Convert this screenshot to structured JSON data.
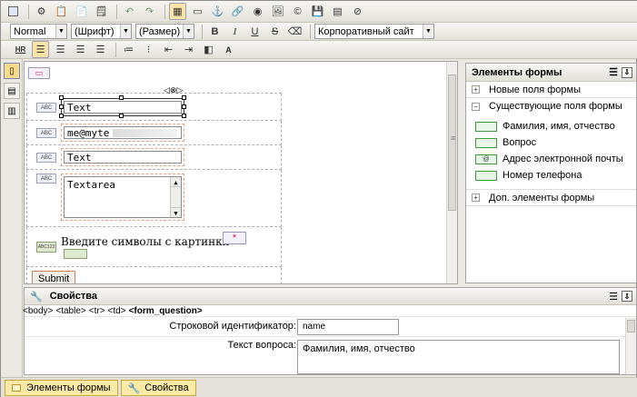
{
  "toolbar": {
    "style_value": "Normal",
    "font_value": "(Шрифт)",
    "size_value": "(Размер)",
    "css_class_value": "Корпоративный сайт",
    "bold": "B",
    "italic": "I",
    "underline": "U",
    "strike": "S",
    "hr": "HR"
  },
  "editor": {
    "rows": [
      {
        "type": "ABC",
        "value": "Text"
      },
      {
        "type": "ABC",
        "value": "me@myte"
      },
      {
        "type": "ABC",
        "value": "Text"
      },
      {
        "type": "ABC",
        "value": "Textarea"
      }
    ],
    "captcha_label": "Введите символы с картинки",
    "captcha_required_mark": "*",
    "captcha_icon_text": "ABC123",
    "submit_label": "Submit"
  },
  "sidepanel": {
    "title": "Элементы формы",
    "sections": [
      {
        "label": "Новые поля формы",
        "expanded": false
      },
      {
        "label": "Существующие поля формы",
        "expanded": true
      },
      {
        "label": "Доп. элементы формы",
        "expanded": false
      }
    ],
    "existing_fields": [
      "Фамилия, имя, отчество",
      "Вопрос",
      "Адрес электронной почты",
      "Номер телефона"
    ]
  },
  "properties": {
    "title": "Свойства",
    "breadcrumb": [
      "<body>",
      "<table>",
      "<tr>",
      "<td>"
    ],
    "breadcrumb_current": "<form_question>",
    "string_id_label": "Строковой идентификатор:",
    "string_id_value": "name",
    "question_text_label": "Текст вопроса:",
    "question_text_value": "Фамилия, имя, отчество"
  },
  "bottom_tabs": {
    "form_elements": "Элементы формы",
    "properties": "Свойства"
  },
  "colors": {
    "accent_tab": "#fbe9a6",
    "field_dashed": "#e8a47a",
    "required": "#d0204a"
  }
}
